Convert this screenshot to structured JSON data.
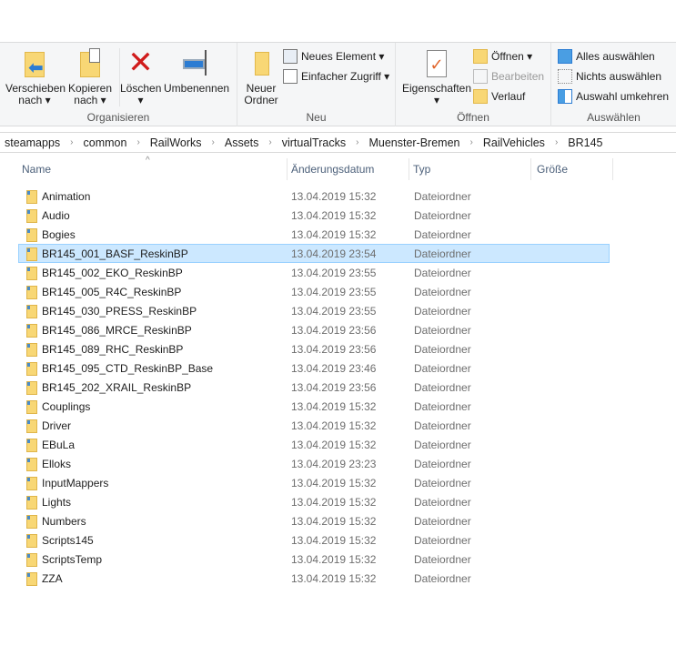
{
  "ribbon": {
    "organisieren": {
      "label": "Organisieren",
      "move": [
        "Verschieben",
        "nach ▾"
      ],
      "copy": [
        "Kopieren",
        "nach ▾"
      ],
      "delete": [
        "Löschen",
        "▾"
      ],
      "rename": "Umbenennen"
    },
    "neu": {
      "label": "Neu",
      "new_folder": [
        "Neuer",
        "Ordner"
      ],
      "new_item": "Neues Element ▾",
      "easy_access": "Einfacher Zugriff ▾"
    },
    "oeffnen": {
      "label": "Öffnen",
      "properties": [
        "Eigenschaften",
        "▾"
      ],
      "open": "Öffnen ▾",
      "edit": "Bearbeiten",
      "history": "Verlauf"
    },
    "auswaehlen": {
      "label": "Auswählen",
      "select_all": "Alles auswählen",
      "select_none": "Nichts auswählen",
      "invert": "Auswahl umkehren"
    }
  },
  "breadcrumb": [
    "steamapps",
    "common",
    "RailWorks",
    "Assets",
    "virtualTracks",
    "Muenster-Bremen",
    "RailVehicles",
    "BR145"
  ],
  "columns": {
    "name": "Name",
    "date": "Änderungsdatum",
    "type": "Typ",
    "size": "Größe"
  },
  "selected_index": 3,
  "files": [
    {
      "name": "Animation",
      "date": "13.04.2019 15:32",
      "type": "Dateiordner"
    },
    {
      "name": "Audio",
      "date": "13.04.2019 15:32",
      "type": "Dateiordner"
    },
    {
      "name": "Bogies",
      "date": "13.04.2019 15:32",
      "type": "Dateiordner"
    },
    {
      "name": "BR145_001_BASF_ReskinBP",
      "date": "13.04.2019 23:54",
      "type": "Dateiordner"
    },
    {
      "name": "BR145_002_EKO_ReskinBP",
      "date": "13.04.2019 23:55",
      "type": "Dateiordner"
    },
    {
      "name": "BR145_005_R4C_ReskinBP",
      "date": "13.04.2019 23:55",
      "type": "Dateiordner"
    },
    {
      "name": "BR145_030_PRESS_ReskinBP",
      "date": "13.04.2019 23:55",
      "type": "Dateiordner"
    },
    {
      "name": "BR145_086_MRCE_ReskinBP",
      "date": "13.04.2019 23:56",
      "type": "Dateiordner"
    },
    {
      "name": "BR145_089_RHC_ReskinBP",
      "date": "13.04.2019 23:56",
      "type": "Dateiordner"
    },
    {
      "name": "BR145_095_CTD_ReskinBP_Base",
      "date": "13.04.2019 23:46",
      "type": "Dateiordner"
    },
    {
      "name": "BR145_202_XRAIL_ReskinBP",
      "date": "13.04.2019 23:56",
      "type": "Dateiordner"
    },
    {
      "name": "Couplings",
      "date": "13.04.2019 15:32",
      "type": "Dateiordner"
    },
    {
      "name": "Driver",
      "date": "13.04.2019 15:32",
      "type": "Dateiordner"
    },
    {
      "name": "EBuLa",
      "date": "13.04.2019 15:32",
      "type": "Dateiordner"
    },
    {
      "name": "Elloks",
      "date": "13.04.2019 23:23",
      "type": "Dateiordner"
    },
    {
      "name": "InputMappers",
      "date": "13.04.2019 15:32",
      "type": "Dateiordner"
    },
    {
      "name": "Lights",
      "date": "13.04.2019 15:32",
      "type": "Dateiordner"
    },
    {
      "name": "Numbers",
      "date": "13.04.2019 15:32",
      "type": "Dateiordner"
    },
    {
      "name": "Scripts145",
      "date": "13.04.2019 15:32",
      "type": "Dateiordner"
    },
    {
      "name": "ScriptsTemp",
      "date": "13.04.2019 15:32",
      "type": "Dateiordner"
    },
    {
      "name": "ZZA",
      "date": "13.04.2019 15:32",
      "type": "Dateiordner"
    }
  ]
}
